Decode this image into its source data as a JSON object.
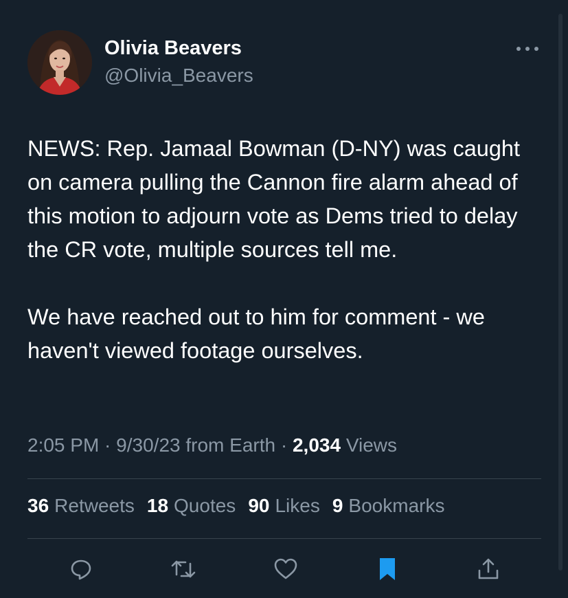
{
  "author": {
    "display_name": "Olivia Beavers",
    "handle": "@Olivia_Beavers",
    "avatar": "profile-photo"
  },
  "tweet": {
    "paragraphs": [
      "NEWS: Rep. Jamaal Bowman (D-NY) was caught on camera pulling the Cannon fire alarm ahead of this motion to adjourn vote as Dems tried to delay the CR vote, multiple sources tell me.",
      "We have reached out to him for comment - we haven't viewed footage ourselves."
    ]
  },
  "meta": {
    "time": "2:05 PM",
    "sep1": " · ",
    "date": "9/30/23",
    "source": " from Earth",
    "sep2": " · ",
    "views_count": "2,034",
    "views_label": " Views"
  },
  "stats": {
    "retweets_count": "36",
    "retweets_label": "Retweets",
    "quotes_count": "18",
    "quotes_label": "Quotes",
    "likes_count": "90",
    "likes_label": "Likes",
    "bookmarks_count": "9",
    "bookmarks_label": "Bookmarks"
  },
  "actions": [
    {
      "name": "reply-icon"
    },
    {
      "name": "retweet-icon"
    },
    {
      "name": "like-icon"
    },
    {
      "name": "bookmark-icon",
      "state": "active"
    },
    {
      "name": "share-icon"
    }
  ],
  "colors": {
    "background": "#15202b",
    "secondary_text": "#8b98a5",
    "divider": "#38444d",
    "accent": "#1d9bf0"
  }
}
